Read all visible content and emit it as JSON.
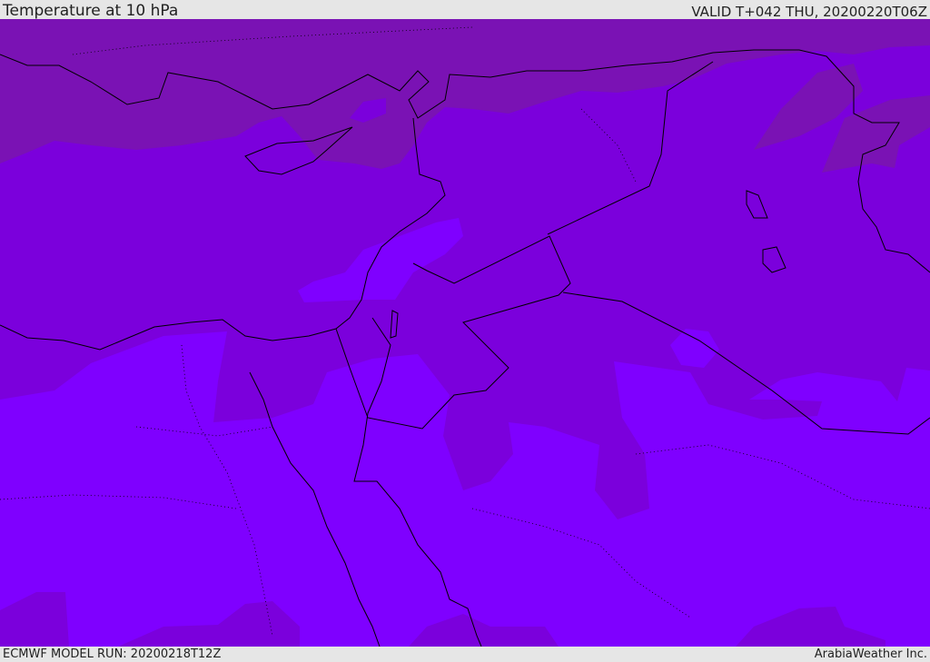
{
  "header": {
    "title": "Temperature at 10 hPa",
    "valid_time": "VALID T+042 THU, 20200220T06Z"
  },
  "footer": {
    "model_run": "ECMWF MODEL RUN: 20200218T12Z",
    "credit": "ArabiaWeather Inc."
  },
  "map": {
    "colors": {
      "cold_band": "#7a12b4",
      "mid_band": "#7b00dc",
      "warm_band": "#7f00ff",
      "coastline": "#000000"
    }
  }
}
